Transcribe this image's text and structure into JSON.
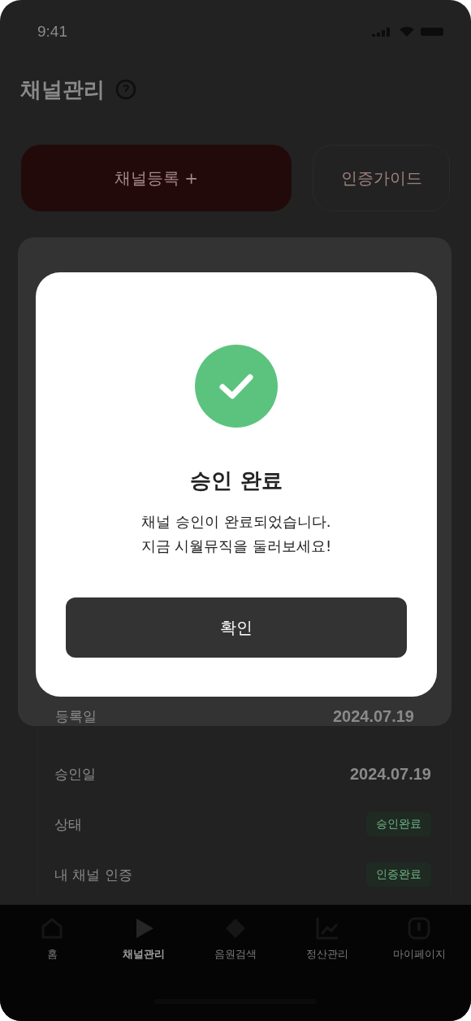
{
  "status_bar": {
    "time": "9:41"
  },
  "header": {
    "title": "채널관리"
  },
  "actions": [
    {
      "label": "채널등록 +",
      "kind": "primary"
    },
    {
      "label": "인증가이드",
      "kind": "outline"
    }
  ],
  "channel_rows": [
    {
      "label": "등록일",
      "value": "2024.07.19",
      "kind": "text"
    },
    {
      "label": "승인일",
      "value": "2024.07.19",
      "kind": "text"
    },
    {
      "label": "상태",
      "value": "승인완료",
      "kind": "badge"
    },
    {
      "label": "내 채널 인증",
      "value": "인증완료",
      "kind": "badge"
    }
  ],
  "dialog": {
    "title": "승인 완료",
    "message_lines": [
      "채널 승인이 완료되었습니다.",
      "지금 시월뮤직을 둘러보세요!"
    ],
    "button": "확인"
  },
  "tab_bar": [
    {
      "label": "홈",
      "selected": false
    },
    {
      "label": "채널관리",
      "selected": true
    },
    {
      "label": "음원검색",
      "selected": false
    },
    {
      "label": "정산관리",
      "selected": false
    },
    {
      "label": "마이페이지",
      "selected": false
    }
  ]
}
